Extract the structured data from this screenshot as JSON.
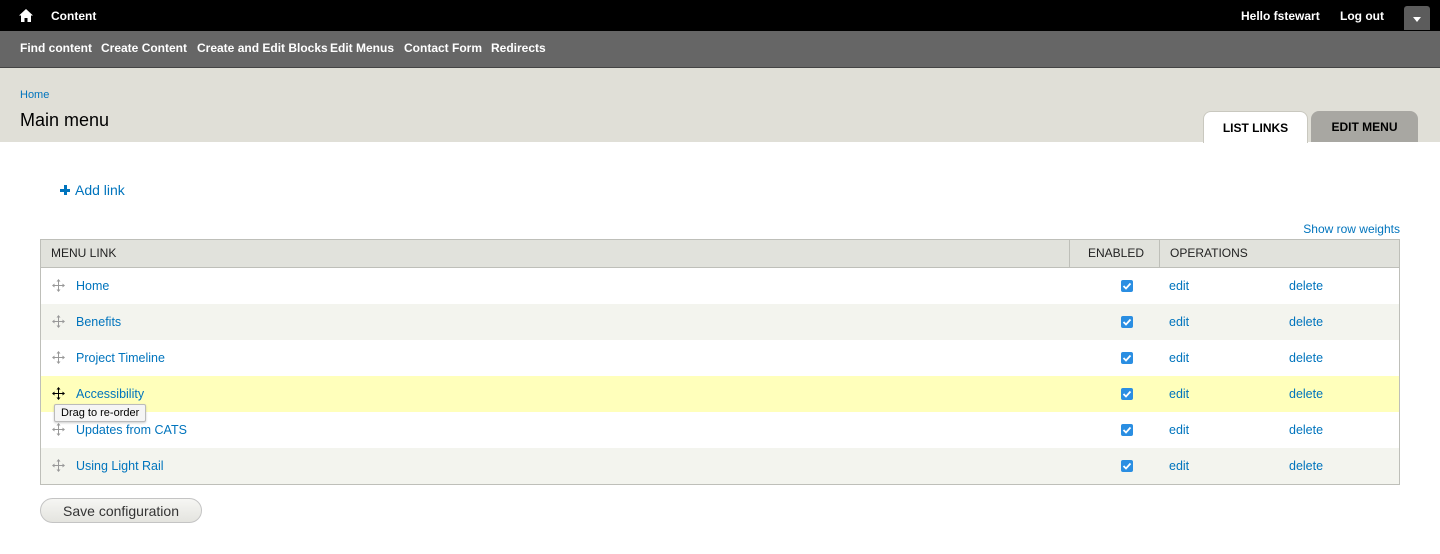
{
  "toolbar": {
    "title": "Content",
    "greeting": "Hello fstewart",
    "logout": "Log out"
  },
  "shortcuts": [
    "Find content",
    "Create Content",
    "Create and Edit Blocks",
    "Edit Menus",
    "Contact Form",
    "Redirects"
  ],
  "breadcrumb": "Home",
  "page_title": "Main menu",
  "tabs": {
    "list_links": "LIST LINKS",
    "edit_menu": "EDIT MENU"
  },
  "add_link": "Add link",
  "show_row_weights": "Show row weights",
  "table": {
    "headers": {
      "menu_link": "MENU LINK",
      "enabled": "ENABLED",
      "operations": "OPERATIONS"
    },
    "rows": [
      {
        "label": "Home",
        "enabled": true,
        "edit": "edit",
        "delete": "delete"
      },
      {
        "label": "Benefits",
        "enabled": true,
        "edit": "edit",
        "delete": "delete"
      },
      {
        "label": "Project Timeline",
        "enabled": true,
        "edit": "edit",
        "delete": "delete"
      },
      {
        "label": "Accessibility",
        "enabled": true,
        "edit": "edit",
        "delete": "delete"
      },
      {
        "label": "Updates from CATS",
        "enabled": true,
        "edit": "edit",
        "delete": "delete"
      },
      {
        "label": "Using Light Rail",
        "enabled": true,
        "edit": "edit",
        "delete": "delete"
      }
    ]
  },
  "tooltip": "Drag to re-order",
  "save_button": "Save configuration",
  "icons": {
    "home": "home-icon",
    "drawer": "chevron-down-icon",
    "add": "plus-icon",
    "drag": "drag-handle-icon",
    "checkbox": "checkmark-icon"
  },
  "colors": {
    "link": "#0074bd",
    "toolbar": "#000000",
    "shortcut_bar": "#666666",
    "header_bg": "#e0dfd7",
    "drag_highlight": "#ffffbb",
    "checkbox": "#2a8ee2"
  }
}
